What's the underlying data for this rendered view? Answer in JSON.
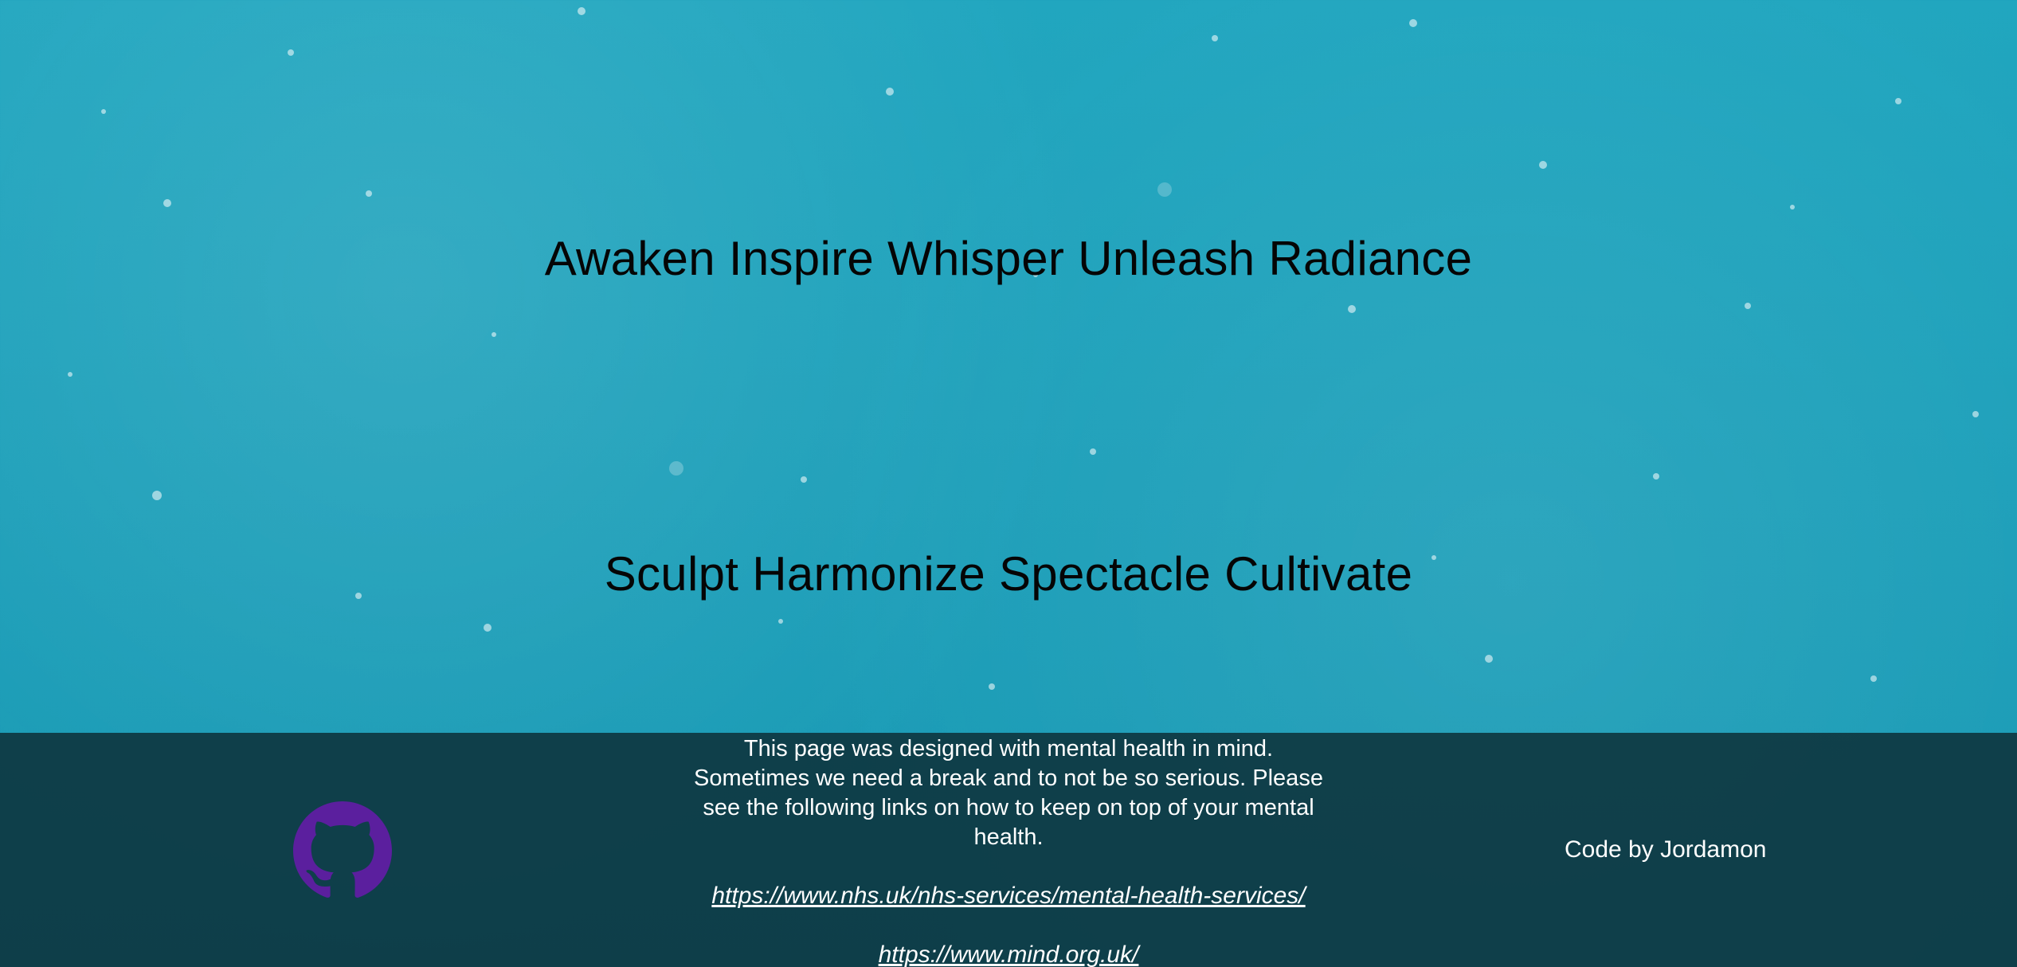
{
  "hero": {
    "line_one": "Awaken Inspire Whisper Unleash Radiance",
    "line_two": "Sculpt Harmonize Spectacle Cultivate"
  },
  "footer": {
    "github_icon": "github-icon",
    "github_color": "#5b1f9e",
    "message": "This page was designed with mental health in mind. Sometimes we need a break and to not be so serious. Please see the following links on how to keep on top of your mental health.",
    "links": [
      "https://www.nhs.uk/nhs-services/mental-health-services/",
      "https://www.mind.org.uk/"
    ],
    "credit": "Code by Jordamon"
  },
  "colors": {
    "background": "#1a9fb8",
    "footer_background": "#0d3038",
    "hero_text": "#050505",
    "footer_text": "#ffffff"
  }
}
